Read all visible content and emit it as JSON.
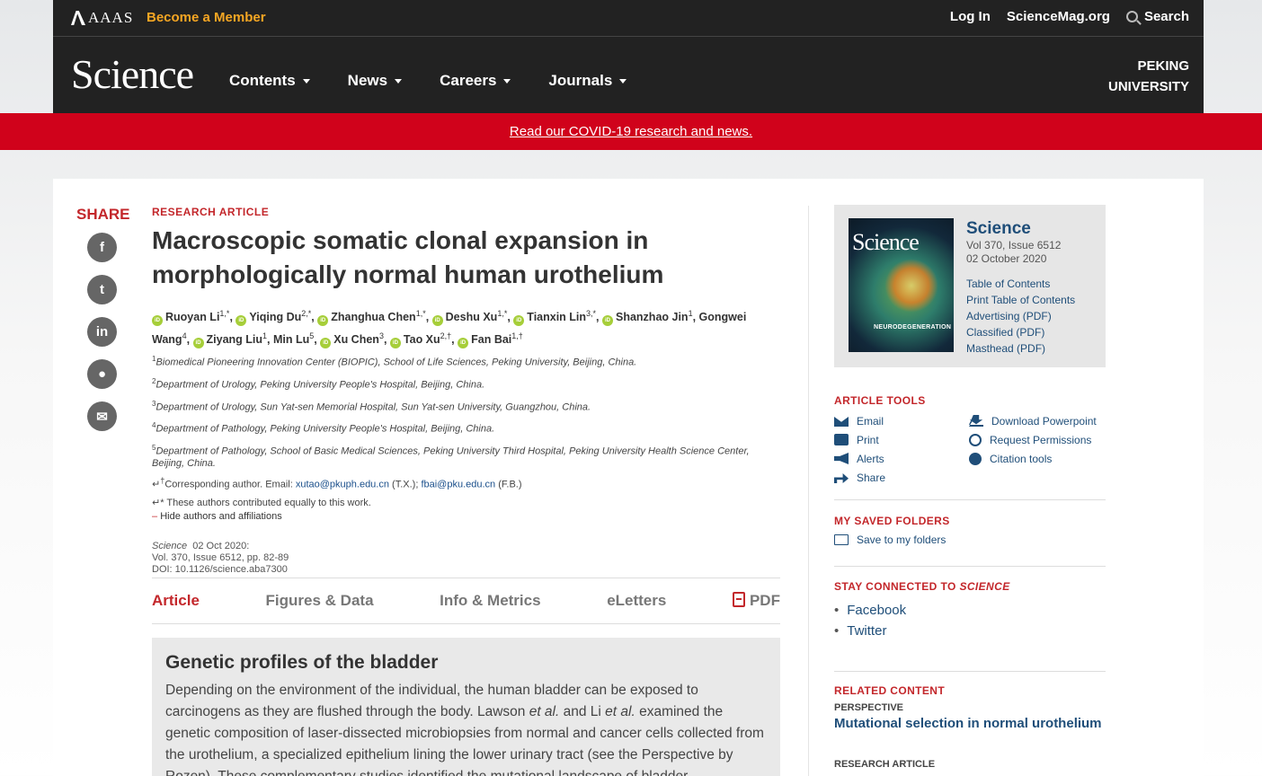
{
  "header": {
    "org": "AAAS",
    "member_link": "Become a Member",
    "login": "Log In",
    "site": "ScienceMag.org",
    "search": "Search",
    "logo": "Science",
    "nav": [
      "Contents",
      "News",
      "Careers",
      "Journals"
    ],
    "institution_line1": "PEKING",
    "institution_line2": "UNIVERSITY"
  },
  "banner": {
    "text": "Read our COVID-19 research and news.",
    "color": "#d0021b"
  },
  "share": {
    "title": "SHARE",
    "buttons": [
      "facebook-icon",
      "twitter-icon",
      "linkedin-icon",
      "reddit-icon",
      "email-icon"
    ]
  },
  "article": {
    "kicker": "RESEARCH ARTICLE",
    "title": "Macroscopic somatic clonal expansion in morphologically normal human urothelium",
    "authors": [
      {
        "name": "Ruoyan Li",
        "sup": "1,*",
        "orcid": true
      },
      {
        "name": "Yiqing Du",
        "sup": "2,*",
        "orcid": true
      },
      {
        "name": "Zhanghua Chen",
        "sup": "1,*",
        "orcid": true
      },
      {
        "name": "Deshu Xu",
        "sup": "1,*",
        "orcid": true
      },
      {
        "name": "Tianxin Lin",
        "sup": "3,*",
        "orcid": true
      },
      {
        "name": "Shanzhao Jin",
        "sup": "1",
        "orcid": true
      },
      {
        "name": "Gongwei Wang",
        "sup": "4",
        "orcid": false
      },
      {
        "name": "Ziyang Liu",
        "sup": "1",
        "orcid": true
      },
      {
        "name": "Min Lu",
        "sup": "5",
        "orcid": false
      },
      {
        "name": "Xu Chen",
        "sup": "3",
        "orcid": true
      },
      {
        "name": "Tao Xu",
        "sup": "2,†",
        "orcid": true
      },
      {
        "name": "Fan Bai",
        "sup": "1,†",
        "orcid": true
      }
    ],
    "affiliations": [
      {
        "num": "1",
        "text": "Biomedical Pioneering Innovation Center (BIOPIC), School of Life Sciences, Peking University, Beijing, China."
      },
      {
        "num": "2",
        "text": "Department of Urology, Peking University People's Hospital, Beijing, China."
      },
      {
        "num": "3",
        "text": "Department of Urology, Sun Yat-sen Memorial Hospital, Sun Yat-sen University, Guangzhou, China."
      },
      {
        "num": "4",
        "text": "Department of Pathology, Peking University People's Hospital, Beijing, China."
      },
      {
        "num": "5",
        "text": "Department of Pathology, School of Basic Medical Sciences, Peking University Third Hospital, Peking University Health Science Center, Beijing, China."
      }
    ],
    "corresponding_prefix": "Corresponding author. Email: ",
    "email1": "xutao@pkuph.edu.cn",
    "email1_suffix": " (T.X.); ",
    "email2": "fbai@pku.edu.cn",
    "email2_suffix": " (F.B.)",
    "equal_note": "* These authors contributed equally to this work.",
    "hide_toggle": "Hide authors and affiliations",
    "journal": "Science",
    "date": "02 Oct 2020:",
    "volume": "Vol. 370, Issue 6512, pp. 82-89",
    "doi": "DOI: 10.1126/science.aba7300"
  },
  "tabs": [
    "Article",
    "Figures & Data",
    "Info & Metrics",
    "eLetters",
    "PDF"
  ],
  "abstract": {
    "heading": "Genetic profiles of the bladder",
    "p1": "Depending on the environment of the individual, the human bladder can be exposed to carcinogens as they are flushed through the body. Lawson ",
    "etal1": "et al.",
    "p2": " and Li ",
    "etal2": "et al.",
    "p3": " examined the genetic composition of laser-dissected microbiopsies from normal and cancer cells collected from the urothelium, a specialized epithelium lining the lower urinary tract (see the Perspective by Rozen). These complementary studies identified the mutational landscape of bladder"
  },
  "issue": {
    "cover_logo": "Science",
    "cover_caption": "NEURODEGENERATION",
    "name": "Science",
    "volume": "Vol 370, Issue 6512",
    "date": "02 October 2020",
    "links": [
      "Table of Contents",
      "Print Table of Contents",
      "Advertising (PDF)",
      "Classified (PDF)",
      "Masthead (PDF)"
    ]
  },
  "tools": {
    "title": "ARTICLE TOOLS",
    "items": [
      "Email",
      "Download Powerpoint",
      "Print",
      "Request Permissions",
      "Alerts",
      "Citation tools",
      "Share"
    ]
  },
  "folders": {
    "title": "MY SAVED FOLDERS",
    "save": "Save to my folders"
  },
  "connected": {
    "title_prefix": "STAY CONNECTED TO ",
    "title_em": "SCIENCE",
    "links": [
      "Facebook",
      "Twitter"
    ]
  },
  "related": {
    "title": "RELATED CONTENT",
    "kicker1": "PERSPECTIVE",
    "link1": "Mutational selection in normal urothelium",
    "kicker2": "RESEARCH ARTICLE"
  }
}
